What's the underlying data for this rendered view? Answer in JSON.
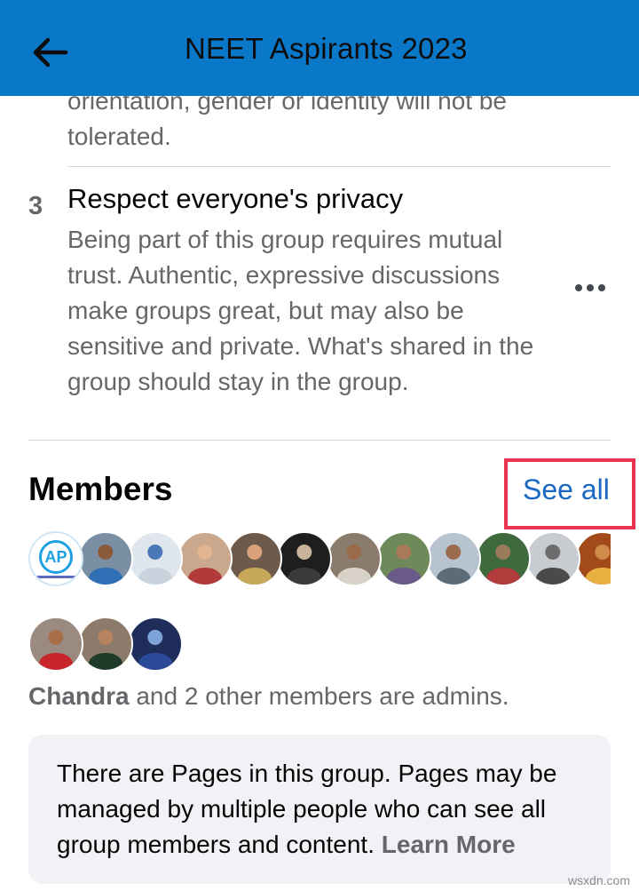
{
  "header": {
    "title": "NEET Aspirants 2023",
    "back_icon": "arrow-left-icon",
    "background_color": "#0a78c8"
  },
  "rules": {
    "previous_rule_tail": "orientation, gender or identity will not be tolerated.",
    "rule3": {
      "number": "3",
      "title": "Respect everyone's privacy",
      "body": "Being part of this group requires mutual trust. Authentic, expressive discussions make groups great, but may also be sensitive and private. What's shared in the group should stay in the group.",
      "more_icon": "more-horizontal-icon"
    }
  },
  "members": {
    "heading": "Members",
    "see_all_label": "See all",
    "highlight_color": "#e8344e",
    "avatars_row1": [
      {
        "kind": "logo",
        "text": "AP",
        "bg": "#ffffff"
      },
      {
        "kind": "photo",
        "bg": "#7a8fa3",
        "face": "#8a5a3c",
        "body": "#2f6fb5"
      },
      {
        "kind": "photo",
        "bg": "#dfe6ee",
        "face": "#4a78b8",
        "body": "#c9d3de"
      },
      {
        "kind": "photo",
        "bg": "#c9a88e",
        "face": "#e2b48f",
        "body": "#b33a3a"
      },
      {
        "kind": "photo",
        "bg": "#6d5a4a",
        "face": "#d9a27a",
        "body": "#c8a85a"
      },
      {
        "kind": "photo",
        "bg": "#1e1e1e",
        "face": "#c9b39a",
        "body": "#3b3b3b"
      },
      {
        "kind": "photo",
        "bg": "#8a7b6c",
        "face": "#9a6a4a",
        "body": "#d8d2c8"
      },
      {
        "kind": "photo",
        "bg": "#6f8a5a",
        "face": "#a77b5a",
        "body": "#6a5a8a"
      },
      {
        "kind": "photo",
        "bg": "#b7c4cf",
        "face": "#9c6b4d",
        "body": "#5b6b78"
      },
      {
        "kind": "photo",
        "bg": "#3e6a3e",
        "face": "#9a7b5a",
        "body": "#b23b3b"
      },
      {
        "kind": "photo",
        "bg": "#c8ccd0",
        "face": "#6d6d6d",
        "body": "#4a4a4a"
      },
      {
        "kind": "photo",
        "bg": "#a24a1a",
        "face": "#d08a4a",
        "body": "#e8b040"
      },
      {
        "kind": "photo",
        "bg": "#d8d8d8",
        "face": "#8a6a5a",
        "body": "#1a1a1a"
      }
    ],
    "avatars_row2": [
      {
        "kind": "photo",
        "bg": "#9a8a80",
        "face": "#a8704a",
        "body": "#c8242c"
      },
      {
        "kind": "photo",
        "bg": "#8c7a6a",
        "face": "#b5835e",
        "body": "#1f3b2a"
      },
      {
        "kind": "photo",
        "bg": "#1f2d5a",
        "face": "#7da3d8",
        "body": "#2c4a9a"
      }
    ],
    "admins_name": "Chandra",
    "admins_rest": " and 2 other members are admins."
  },
  "info_box": {
    "text": "There are Pages in this group. Pages may be managed by multiple people who can see all group members and content.",
    "learn_more": "Learn More"
  },
  "watermark": "wsxdn.com"
}
